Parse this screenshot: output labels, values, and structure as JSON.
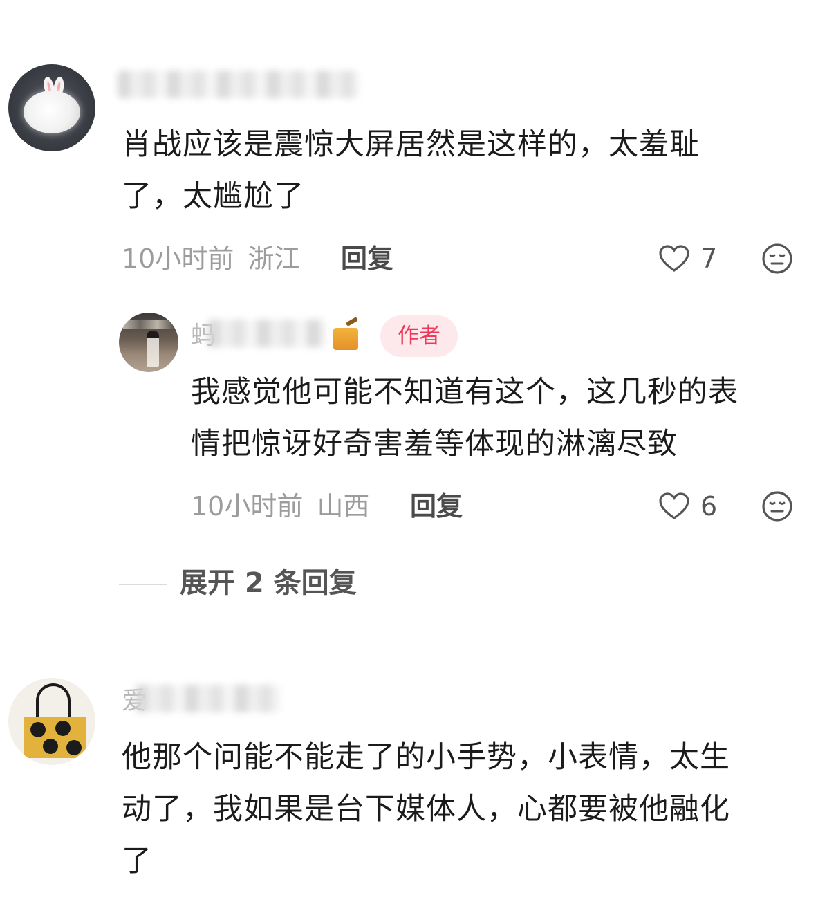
{
  "comments": [
    {
      "username": "",
      "text_lines": [
        "肖战应该是震惊大屏居然是这样的，太羞耻",
        "了，太尴尬了"
      ],
      "time": "10小时前",
      "location": "浙江",
      "reply_label": "回复",
      "likes": "7",
      "avatar_icon": "rabbit-avatar"
    },
    {
      "username_visible_char": "蚂",
      "author_tag": "作者",
      "text_lines": [
        "我感觉他可能不知道有这个，这几秒的表",
        "情把惊讶好奇害羞等体现的淋漓尽致"
      ],
      "time": "10小时前",
      "location": "山西",
      "reply_label": "回复",
      "likes": "6",
      "avatar_icon": "girl-avatar",
      "badge_icon": "honey-jar-icon"
    },
    {
      "username_visible_char": "爱",
      "text_lines": [
        "他那个问能不能走了的小手势，小表情，太生",
        "动了，我如果是台下媒体人，心都要被他融化",
        "了"
      ],
      "avatar_icon": "tote-bag-avatar"
    }
  ],
  "expand_replies": {
    "label": "展开 2 条回复"
  },
  "colors": {
    "author_tag_bg": "#fde8ec",
    "author_tag_text": "#ee3a5a",
    "meta_text": "#9c9c9c"
  }
}
